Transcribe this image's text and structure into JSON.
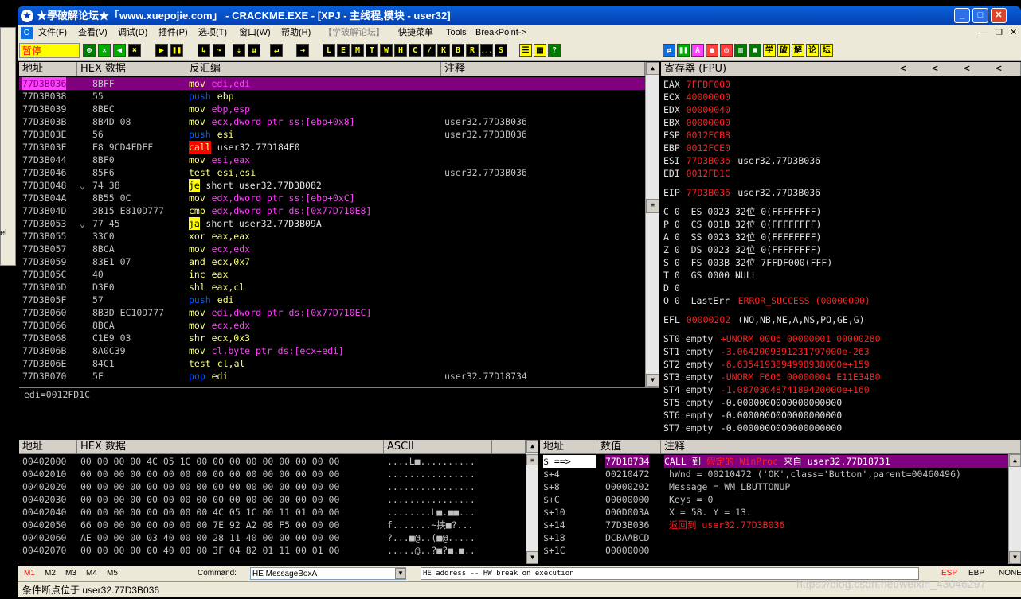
{
  "window": {
    "title": "★學破解论坛★「www.xuepojie.com」 - CRACKME.EXE - [XPJ - 主线程,模块 - user32]"
  },
  "menu": [
    "文件(F)",
    "查看(V)",
    "调试(D)",
    "插件(P)",
    "选项(T)",
    "窗口(W)",
    "帮助(H)",
    "【学破解论坛】",
    "快捷菜单",
    "Tools",
    "BreakPoint->"
  ],
  "toolbar": {
    "status": "暂停",
    "letters": [
      "L",
      "E",
      "M",
      "T",
      "W",
      "H",
      "C",
      "/",
      "K",
      "B",
      "R",
      "...",
      "S"
    ],
    "cn_buttons": [
      "学",
      "破",
      "解",
      "论",
      "坛"
    ]
  },
  "disasm": {
    "headers": [
      "地址",
      "HEX 数据",
      "反汇编",
      "注释"
    ],
    "rows": [
      {
        "addr": "77D3B036",
        "hex": "8BFF",
        "op": "mov",
        "args": "edi,edi",
        "comment": "",
        "sel": true
      },
      {
        "addr": "77D3B038",
        "hex": "55",
        "op": "push",
        "args": "ebp",
        "comment": ""
      },
      {
        "addr": "77D3B039",
        "hex": "8BEC",
        "op": "mov",
        "args": "ebp,esp",
        "comment": ""
      },
      {
        "addr": "77D3B03B",
        "hex": "8B4D 08",
        "op": "mov",
        "args": "ecx,dword ptr ss:[ebp+0x8]",
        "comment": "user32.77D3B036"
      },
      {
        "addr": "77D3B03E",
        "hex": "56",
        "op": "push",
        "args": "esi",
        "comment": "user32.77D3B036"
      },
      {
        "addr": "77D3B03F",
        "hex": "E8 9CD4FDFF",
        "op": "call",
        "args": "user32.77D184E0",
        "comment": ""
      },
      {
        "addr": "77D3B044",
        "hex": "8BF0",
        "op": "mov",
        "args": "esi,eax",
        "comment": ""
      },
      {
        "addr": "77D3B046",
        "hex": "85F6",
        "op": "test",
        "args": "esi,esi",
        "comment": "user32.77D3B036"
      },
      {
        "addr": "77D3B048",
        "hex": "74 38",
        "op": "je",
        "args": "short user32.77D3B082",
        "comment": "",
        "mark": "⌄"
      },
      {
        "addr": "77D3B04A",
        "hex": "8B55 0C",
        "op": "mov",
        "args": "edx,dword ptr ss:[ebp+0xC]",
        "comment": ""
      },
      {
        "addr": "77D3B04D",
        "hex": "3B15 E810D777",
        "op": "cmp",
        "args": "edx,dword ptr ds:[0x77D710E8]",
        "comment": ""
      },
      {
        "addr": "77D3B053",
        "hex": "77 45",
        "op": "ja",
        "args": "short user32.77D3B09A",
        "comment": "",
        "mark": "⌄"
      },
      {
        "addr": "77D3B055",
        "hex": "33C0",
        "op": "xor",
        "args": "eax,eax",
        "comment": ""
      },
      {
        "addr": "77D3B057",
        "hex": "8BCA",
        "op": "mov",
        "args": "ecx,edx",
        "comment": ""
      },
      {
        "addr": "77D3B059",
        "hex": "83E1 07",
        "op": "and",
        "args": "ecx,0x7",
        "comment": ""
      },
      {
        "addr": "77D3B05C",
        "hex": "40",
        "op": "inc",
        "args": "eax",
        "comment": ""
      },
      {
        "addr": "77D3B05D",
        "hex": "D3E0",
        "op": "shl",
        "args": "eax,cl",
        "comment": ""
      },
      {
        "addr": "77D3B05F",
        "hex": "57",
        "op": "push",
        "args": "edi",
        "comment": ""
      },
      {
        "addr": "77D3B060",
        "hex": "8B3D EC10D777",
        "op": "mov",
        "args": "edi,dword ptr ds:[0x77D710EC]",
        "comment": ""
      },
      {
        "addr": "77D3B066",
        "hex": "8BCA",
        "op": "mov",
        "args": "ecx,edx",
        "comment": ""
      },
      {
        "addr": "77D3B068",
        "hex": "C1E9 03",
        "op": "shr",
        "args": "ecx,0x3",
        "comment": ""
      },
      {
        "addr": "77D3B06B",
        "hex": "8A0C39",
        "op": "mov",
        "args": "cl,byte ptr ds:[ecx+edi]",
        "comment": ""
      },
      {
        "addr": "77D3B06E",
        "hex": "84C1",
        "op": "test",
        "args": "cl,al",
        "comment": ""
      },
      {
        "addr": "77D3B070",
        "hex": "5F",
        "op": "pop",
        "args": "edi",
        "comment": "user32.77D18734"
      }
    ],
    "info": "edi=0012FD1C"
  },
  "registers": {
    "header": "寄存器 (FPU)",
    "gp": [
      {
        "name": "EAX",
        "val": "7FFDF000",
        "note": ""
      },
      {
        "name": "ECX",
        "val": "40000000",
        "note": ""
      },
      {
        "name": "EDX",
        "val": "00000040",
        "note": ""
      },
      {
        "name": "EBX",
        "val": "00000000",
        "note": ""
      },
      {
        "name": "ESP",
        "val": "0012FCB8",
        "note": ""
      },
      {
        "name": "EBP",
        "val": "0012FCE0",
        "note": ""
      },
      {
        "name": "ESI",
        "val": "77D3B036",
        "note": "user32.77D3B036"
      },
      {
        "name": "EDI",
        "val": "0012FD1C",
        "note": ""
      }
    ],
    "eip": {
      "name": "EIP",
      "val": "77D3B036",
      "note": "user32.77D3B036"
    },
    "flags": [
      "C 0  ES 0023 32位 0(FFFFFFFF)",
      "P 0  CS 001B 32位 0(FFFFFFFF)",
      "A 0  SS 0023 32位 0(FFFFFFFF)",
      "Z 0  DS 0023 32位 0(FFFFFFFF)",
      "S 0  FS 003B 32位 7FFDF000(FFF)",
      "T 0  GS 0000 NULL",
      "D 0"
    ],
    "lasterr": {
      "prefix": "O 0  LastErr ",
      "val": "ERROR_SUCCESS (00000000)"
    },
    "efl": {
      "prefix": "EFL ",
      "val": "00000202",
      "note": " (NO,NB,NE,A,NS,PO,GE,G)"
    },
    "st": [
      {
        "name": "ST0 empty",
        "val": "+UNORM 0006 00000001 00000280"
      },
      {
        "name": "ST1 empty",
        "val": "-3.0642009391231797000e-263"
      },
      {
        "name": "ST2 empty",
        "val": "-6.6354193894998938000e+159"
      },
      {
        "name": "ST3 empty",
        "val": "-UNORM F606 00000004 E11E34B0"
      },
      {
        "name": "ST4 empty",
        "val": "-1.0870304874189420000e+160"
      },
      {
        "name": "ST5 empty",
        "val": "-0.0000000000000000000"
      },
      {
        "name": "ST6 empty",
        "val": "-0.0000000000000000000"
      },
      {
        "name": "ST7 empty",
        "val": "-0.0000000000000000000"
      }
    ],
    "arrows": [
      "<",
      "<",
      "<",
      "<"
    ]
  },
  "dump": {
    "headers": [
      "地址",
      "HEX 数据",
      "ASCII"
    ],
    "rows": [
      {
        "addr": "00402000",
        "hex": "00 00 00 00 4C 05 1C 00 00 00 00 00 00 00 00 00",
        "ascii": "....L■.........."
      },
      {
        "addr": "00402010",
        "hex": "00 00 00 00 00 00 00 00 00 00 00 00 00 00 00 00",
        "ascii": "................"
      },
      {
        "addr": "00402020",
        "hex": "00 00 00 00 00 00 00 00 00 00 00 00 00 00 00 00",
        "ascii": "................"
      },
      {
        "addr": "00402030",
        "hex": "00 00 00 00 00 00 00 00 00 00 00 00 00 00 00 00",
        "ascii": "................"
      },
      {
        "addr": "00402040",
        "hex": "00 00 00 00 00 00 00 00 4C 05 1C 00 11 01 00 00",
        "ascii": "........L■.■■..."
      },
      {
        "addr": "00402050",
        "hex": "66 00 00 00 00 00 00 00 7E 92 A2 08 F5 00 00 00",
        "ascii": "f.......~挟■?..."
      },
      {
        "addr": "00402060",
        "hex": "AE 00 00 00 03 40 00 00 28 11 40 00 00 00 00 00",
        "ascii": "?...■@..(■@....."
      },
      {
        "addr": "00402070",
        "hex": "00 00 00 00 00 40 00 00 3F 04 82 01 11 00 01 00",
        "ascii": ".....@..?■?■.■.."
      }
    ]
  },
  "stack": {
    "headers": [
      "地址",
      "数值",
      "注释"
    ],
    "rows": [
      {
        "addr": "$ ==>",
        "val": "77D18734",
        "comment": "CALL 到 ",
        "c2": "假定的 WinProc",
        "c3": " 来自 user32.77D18731",
        "sel": true
      },
      {
        "addr": "$+4",
        "val": "00210472",
        "comment": "hWnd = 00210472 ('OK',class='Button',parent=00460496)"
      },
      {
        "addr": "$+8",
        "val": "00000202",
        "comment": "Message = WM_LBUTTONUP"
      },
      {
        "addr": "$+C",
        "val": "00000000",
        "comment": "Keys = 0"
      },
      {
        "addr": "$+10",
        "val": "000D003A",
        "comment": "X = 58. Y = 13."
      },
      {
        "addr": "$+14",
        "val": "77D3B036",
        "comment": "返回到 user32.77D3B036",
        "ret": true
      },
      {
        "addr": "$+18",
        "val": "DCBAABCD",
        "comment": ""
      },
      {
        "addr": "$+1C",
        "val": "00000000",
        "comment": ""
      }
    ]
  },
  "bottom": {
    "marks": [
      "M1",
      "M2",
      "M3",
      "M4",
      "M5"
    ],
    "command_label": "Command:",
    "command_value": "HE MessageBoxA",
    "hint": "HE address -- HW break on execution",
    "regs": [
      "ESP",
      "EBP",
      "NONE"
    ]
  },
  "status": "条件断点位于 user32.77D3B036",
  "watermark": "https://blog.csdn.net/weixin_43046297"
}
